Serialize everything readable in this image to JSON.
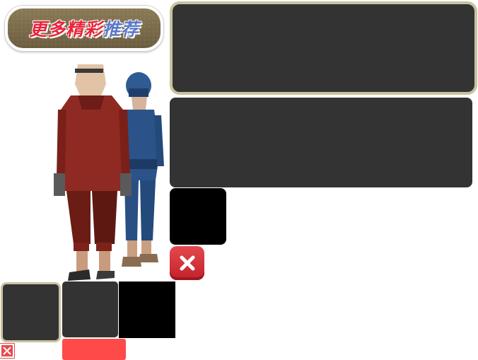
{
  "promo": {
    "title_part1": "更多精彩",
    "title_part2": "推荐"
  },
  "colors": {
    "title_red": "#e8243a",
    "title_blue": "#5b79c9",
    "panel_dark": "#333333",
    "panel_border": "#c8c2a0",
    "close_red": "#d6333b",
    "bar_red": "#ff4a4a"
  },
  "icons": {
    "close": "close-icon",
    "close_small": "close-icon"
  }
}
